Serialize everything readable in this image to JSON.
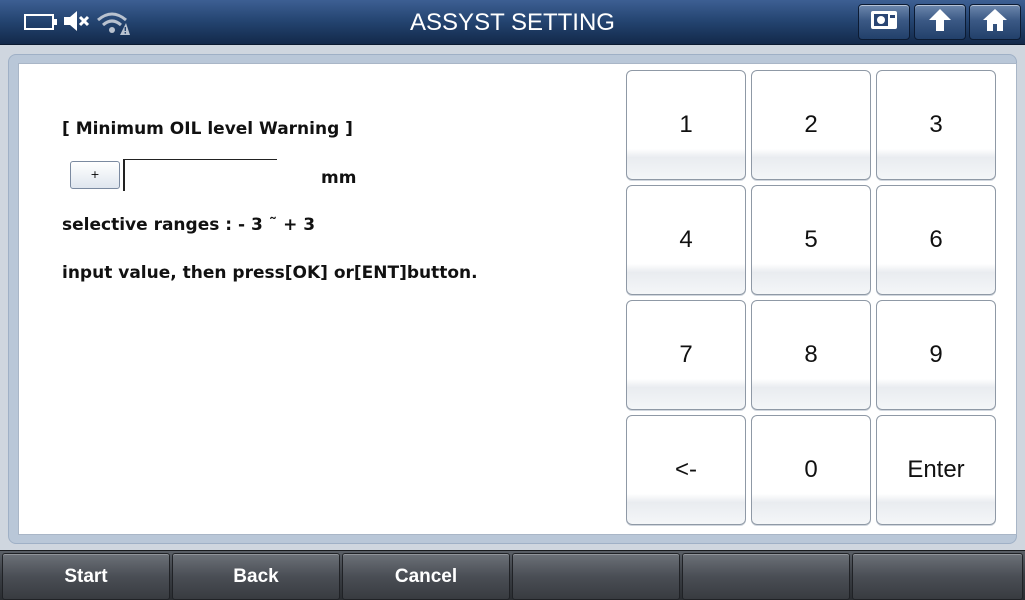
{
  "header": {
    "title": "ASSYST SETTING",
    "status_icons": [
      "battery-icon",
      "mute-speaker-icon",
      "wifi-warning-icon"
    ],
    "buttons": [
      "screenshot-icon",
      "upload-icon",
      "home-icon"
    ]
  },
  "form": {
    "heading": "[ Minimum OIL level Warning ]",
    "sign_button_label": "+",
    "input_value": "",
    "unit": "mm",
    "range_text": "selective ranges : - 3 ˜ + 3",
    "instruction": "input value, then press[OK] or[ENT]button."
  },
  "keypad": {
    "keys": [
      "1",
      "2",
      "3",
      "4",
      "5",
      "6",
      "7",
      "8",
      "9",
      "<-",
      "0",
      "Enter"
    ]
  },
  "footer": {
    "buttons": [
      "Start",
      "Back",
      "Cancel",
      "",
      "",
      ""
    ]
  },
  "colors": {
    "title_bar": "#23436f",
    "panel_background": "#ffffff",
    "footer_bar": "#3a3e44"
  }
}
